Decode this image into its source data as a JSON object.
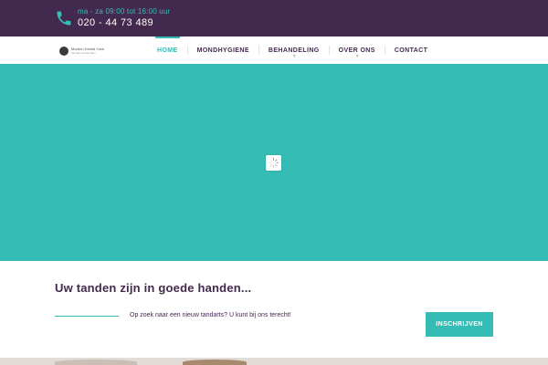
{
  "topbar": {
    "hours": "ma - za 09:00 tot 16:00 uur",
    "phone": "020 - 44 73 489",
    "icon": "phone-icon"
  },
  "logo": {
    "name": "Modern Dental Care",
    "tagline": "tandarts amsterdam"
  },
  "nav": {
    "items": [
      {
        "label": "HOME",
        "active": true,
        "has_submenu": false
      },
      {
        "label": "MONDHYGIENE",
        "active": false,
        "has_submenu": false
      },
      {
        "label": "BEHANDELING",
        "active": false,
        "has_submenu": true
      },
      {
        "label": "OVER ONS",
        "active": false,
        "has_submenu": true
      },
      {
        "label": "CONTACT",
        "active": false,
        "has_submenu": false
      }
    ]
  },
  "hero": {
    "loading_icon": "spinner-icon"
  },
  "intro": {
    "heading": "Uw tanden zijn in goede handen...",
    "text": "Op zoek naar een nieuw tandarts? U kunt bij ons terecht!",
    "button_label": "INSCHRIJVEN"
  },
  "colors": {
    "primary": "#44294f",
    "accent": "#35bcb5",
    "background": "#ffffff"
  }
}
